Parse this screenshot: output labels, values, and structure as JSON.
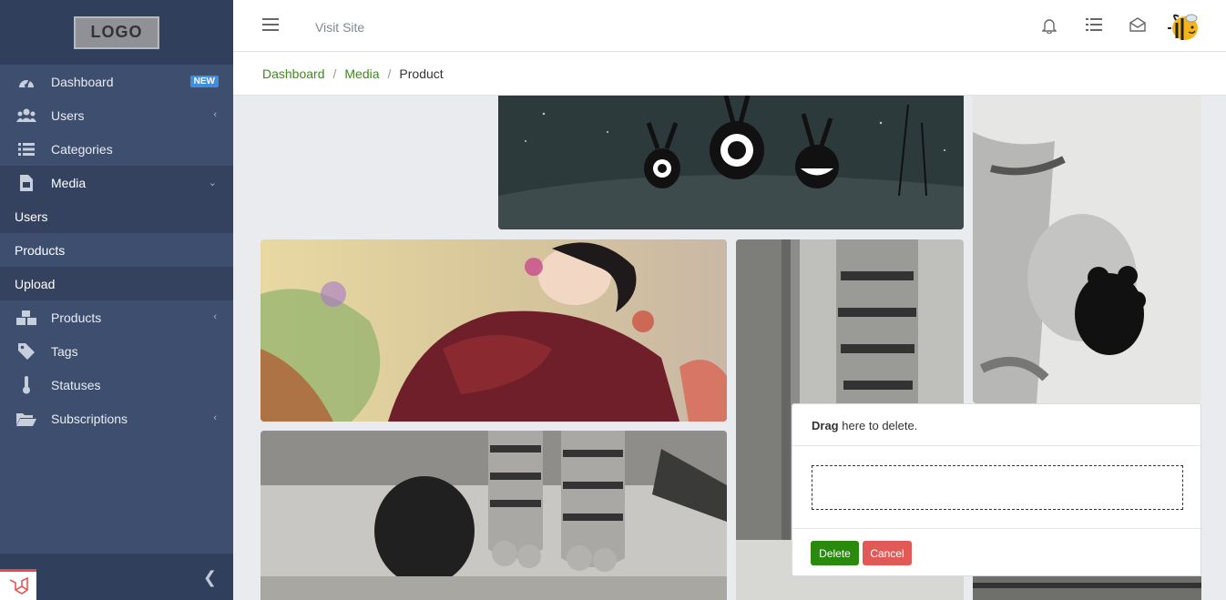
{
  "sidebar": {
    "logo": "LOGO",
    "items": [
      {
        "label": "Dashboard",
        "badge": "NEW"
      },
      {
        "label": "Users"
      },
      {
        "label": "Categories"
      },
      {
        "label": "Media"
      },
      {
        "label": "Products"
      },
      {
        "label": "Tags"
      },
      {
        "label": "Statuses"
      },
      {
        "label": "Subscriptions"
      }
    ],
    "media_sub": [
      "Users",
      "Products",
      "Upload"
    ]
  },
  "topbar": {
    "visit_site": "Visit Site"
  },
  "breadcrumb": [
    "Dashboard",
    "Media",
    "Product"
  ],
  "drop_panel": {
    "title_bold": "Drag",
    "title_rest": " here to delete.",
    "delete_label": "Delete",
    "cancel_label": "Cancel"
  },
  "colors": {
    "sidebar": "#3e4e6e",
    "link": "#3d8a1a",
    "delete": "#2a8a0e",
    "cancel": "#e15a58",
    "badge": "#3d8ede"
  }
}
